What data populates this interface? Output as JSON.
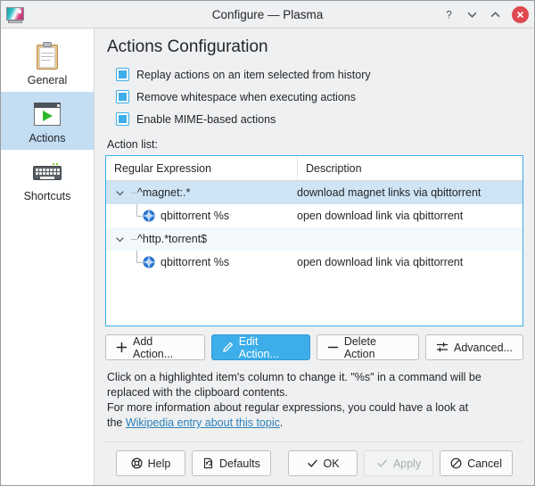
{
  "window": {
    "title": "Configure — Plasma",
    "app_icon": "plasma-monitor-icon",
    "controls": {
      "help": "?",
      "minimize": "chevron-down-icon",
      "maximize": "chevron-up-icon",
      "close": "close-icon"
    }
  },
  "sidebar": {
    "items": [
      {
        "label": "General",
        "icon": "clipboard-icon",
        "selected": false
      },
      {
        "label": "Actions",
        "icon": "window-play-icon",
        "selected": true
      },
      {
        "label": "Shortcuts",
        "icon": "keyboard-icon",
        "selected": false
      }
    ]
  },
  "main": {
    "title": "Actions Configuration",
    "checkboxes": [
      {
        "label": "Replay actions on an item selected from history",
        "state": "filled"
      },
      {
        "label": "Remove whitespace when executing actions",
        "state": "filled"
      },
      {
        "label": "Enable MIME-based actions",
        "state": "filled"
      }
    ],
    "list_label": "Action list:",
    "table": {
      "columns": [
        "Regular Expression",
        "Description"
      ],
      "rows": [
        {
          "level": 0,
          "expanded": true,
          "selected": true,
          "alt": false,
          "icon": null,
          "regex": "^magnet:.*",
          "description": "download magnet links via qbittorrent"
        },
        {
          "level": 1,
          "expanded": false,
          "selected": false,
          "alt": false,
          "icon": "globe-icon",
          "regex": "qbittorrent %s",
          "description": "open download link via qbittorrent"
        },
        {
          "level": 0,
          "expanded": true,
          "selected": false,
          "alt": true,
          "icon": null,
          "regex": "^http.*torrent$",
          "description": ""
        },
        {
          "level": 1,
          "expanded": false,
          "selected": false,
          "alt": false,
          "icon": "globe-icon",
          "regex": "qbittorrent %s",
          "description": "open download link via qbittorrent"
        }
      ]
    },
    "action_buttons": [
      {
        "label": "Add Action...",
        "icon": "plus-icon",
        "primary": false
      },
      {
        "label": "Edit Action...",
        "icon": "pencil-icon",
        "primary": true
      },
      {
        "label": "Delete Action",
        "icon": "minus-icon",
        "primary": false
      },
      {
        "label": "Advanced...",
        "icon": "sliders-icon",
        "primary": false
      }
    ],
    "help_text": {
      "line1": "Click on a highlighted item's column to change it. \"%s\" in a command will be",
      "line2": "replaced with the clipboard contents.",
      "line3": "For more information about regular expressions, you could have a look at",
      "line4_prefix": "the ",
      "link": "Wikipedia entry about this topic",
      "line4_suffix": "."
    }
  },
  "footer": {
    "buttons": [
      {
        "label": "Help",
        "icon": "lifebuoy-icon",
        "disabled": false
      },
      {
        "label": "Defaults",
        "icon": "revert-icon",
        "disabled": false
      },
      {
        "label": "OK",
        "icon": "check-icon",
        "disabled": false
      },
      {
        "label": "Apply",
        "icon": "check-icon",
        "disabled": true
      },
      {
        "label": "Cancel",
        "icon": "no-entry-icon",
        "disabled": false
      }
    ]
  },
  "colors": {
    "accent": "#3daee9",
    "selection": "#cfe5f5",
    "sidebar_selection": "#c3ddf2",
    "close": "#e0484f",
    "link": "#2980b9",
    "window_bg": "#eff0f1"
  }
}
